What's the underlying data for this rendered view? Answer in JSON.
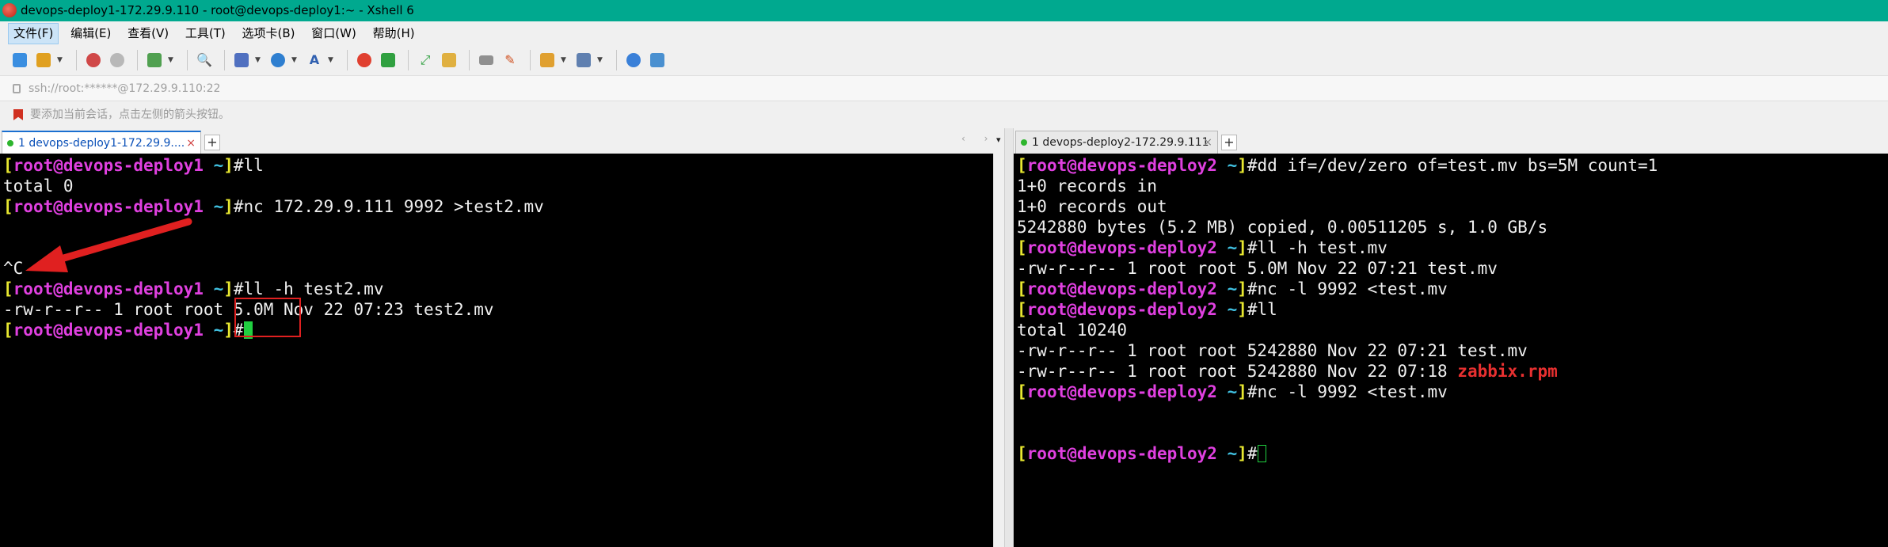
{
  "window": {
    "title": "devops-deploy1-172.29.9.110 - root@devops-deploy1:~ - Xshell 6"
  },
  "menu": [
    {
      "label": "文件(F)",
      "active": true
    },
    {
      "label": "编辑(E)"
    },
    {
      "label": "查看(V)"
    },
    {
      "label": "工具(T)"
    },
    {
      "label": "选项卡(B)"
    },
    {
      "label": "窗口(W)"
    },
    {
      "label": "帮助(H)"
    }
  ],
  "toolbar_icons": [
    "new-session-icon",
    "open-folder-icon",
    "connect-icon",
    "disconnect-icon",
    "new-window-icon",
    "search-icon",
    "layout-icon",
    "globe-icon",
    "font-icon",
    "xftp-icon",
    "xmanager-icon",
    "fullscreen-icon",
    "lock-icon",
    "keyboard-icon",
    "highlight-icon",
    "compose-icon",
    "tile-icon",
    "help-icon",
    "chat-icon"
  ],
  "address": {
    "text": "ssh://root:******@172.29.9.110:22"
  },
  "hint": {
    "text": "要添加当前会话，点击左侧的箭头按钮。"
  },
  "tabs": {
    "left": {
      "label": "1 devops-deploy1-172.29.9....",
      "close": "×"
    },
    "right": {
      "label": "1 devops-deploy2-172.29.9.111",
      "close": "×"
    },
    "add": "+",
    "nav_arrows": "‹ ›",
    "nav_menu": "▾"
  },
  "left_terminal": {
    "user": "root",
    "host": "devops-deploy1",
    "lines": {
      "cmd_ll": "ll",
      "out_total": "total 0",
      "cmd_nc": "nc 172.29.9.111 9992 >test2.mv",
      "ctrl_c": "^C",
      "cmd_llh": "ll -h test2.mv",
      "out_file": "-rw-r--r-- 1 root root 5.0M Nov 22 07:23 test2.mv"
    }
  },
  "right_terminal": {
    "user": "root",
    "host": "devops-deploy2",
    "lines": {
      "cmd_dd": "dd if=/dev/zero of=test.mv bs=5M count=1",
      "out_in": "1+0 records in",
      "out_out": "1+0 records out",
      "out_bytes": "5242880 bytes (5.2 MB) copied, 0.00511205 s, 1.0 GB/s",
      "cmd_llh": "ll -h test.mv",
      "out_llh": "-rw-r--r-- 1 root root 5.0M Nov 22 07:21 test.mv",
      "cmd_nc1": "nc -l 9992 <test.mv",
      "cmd_ll": "ll",
      "out_total": "total 10240",
      "out_file1": "-rw-r--r-- 1 root root 5242880 Nov 22 07:21 test.mv",
      "out_file2_prefix": "-rw-r--r-- 1 root root 5242880 Nov 22 07:18 ",
      "out_file2_name": "zabbix.rpm",
      "cmd_nc2": "nc -l 9992 <test.mv"
    }
  },
  "colors": {
    "titlebar": "#00a98f",
    "prompt_bracket": "#e8e830",
    "prompt_user": "#e040e0",
    "prompt_tilde": "#40c0e0",
    "cursor": "#20d040",
    "annotation": "#e02020"
  }
}
